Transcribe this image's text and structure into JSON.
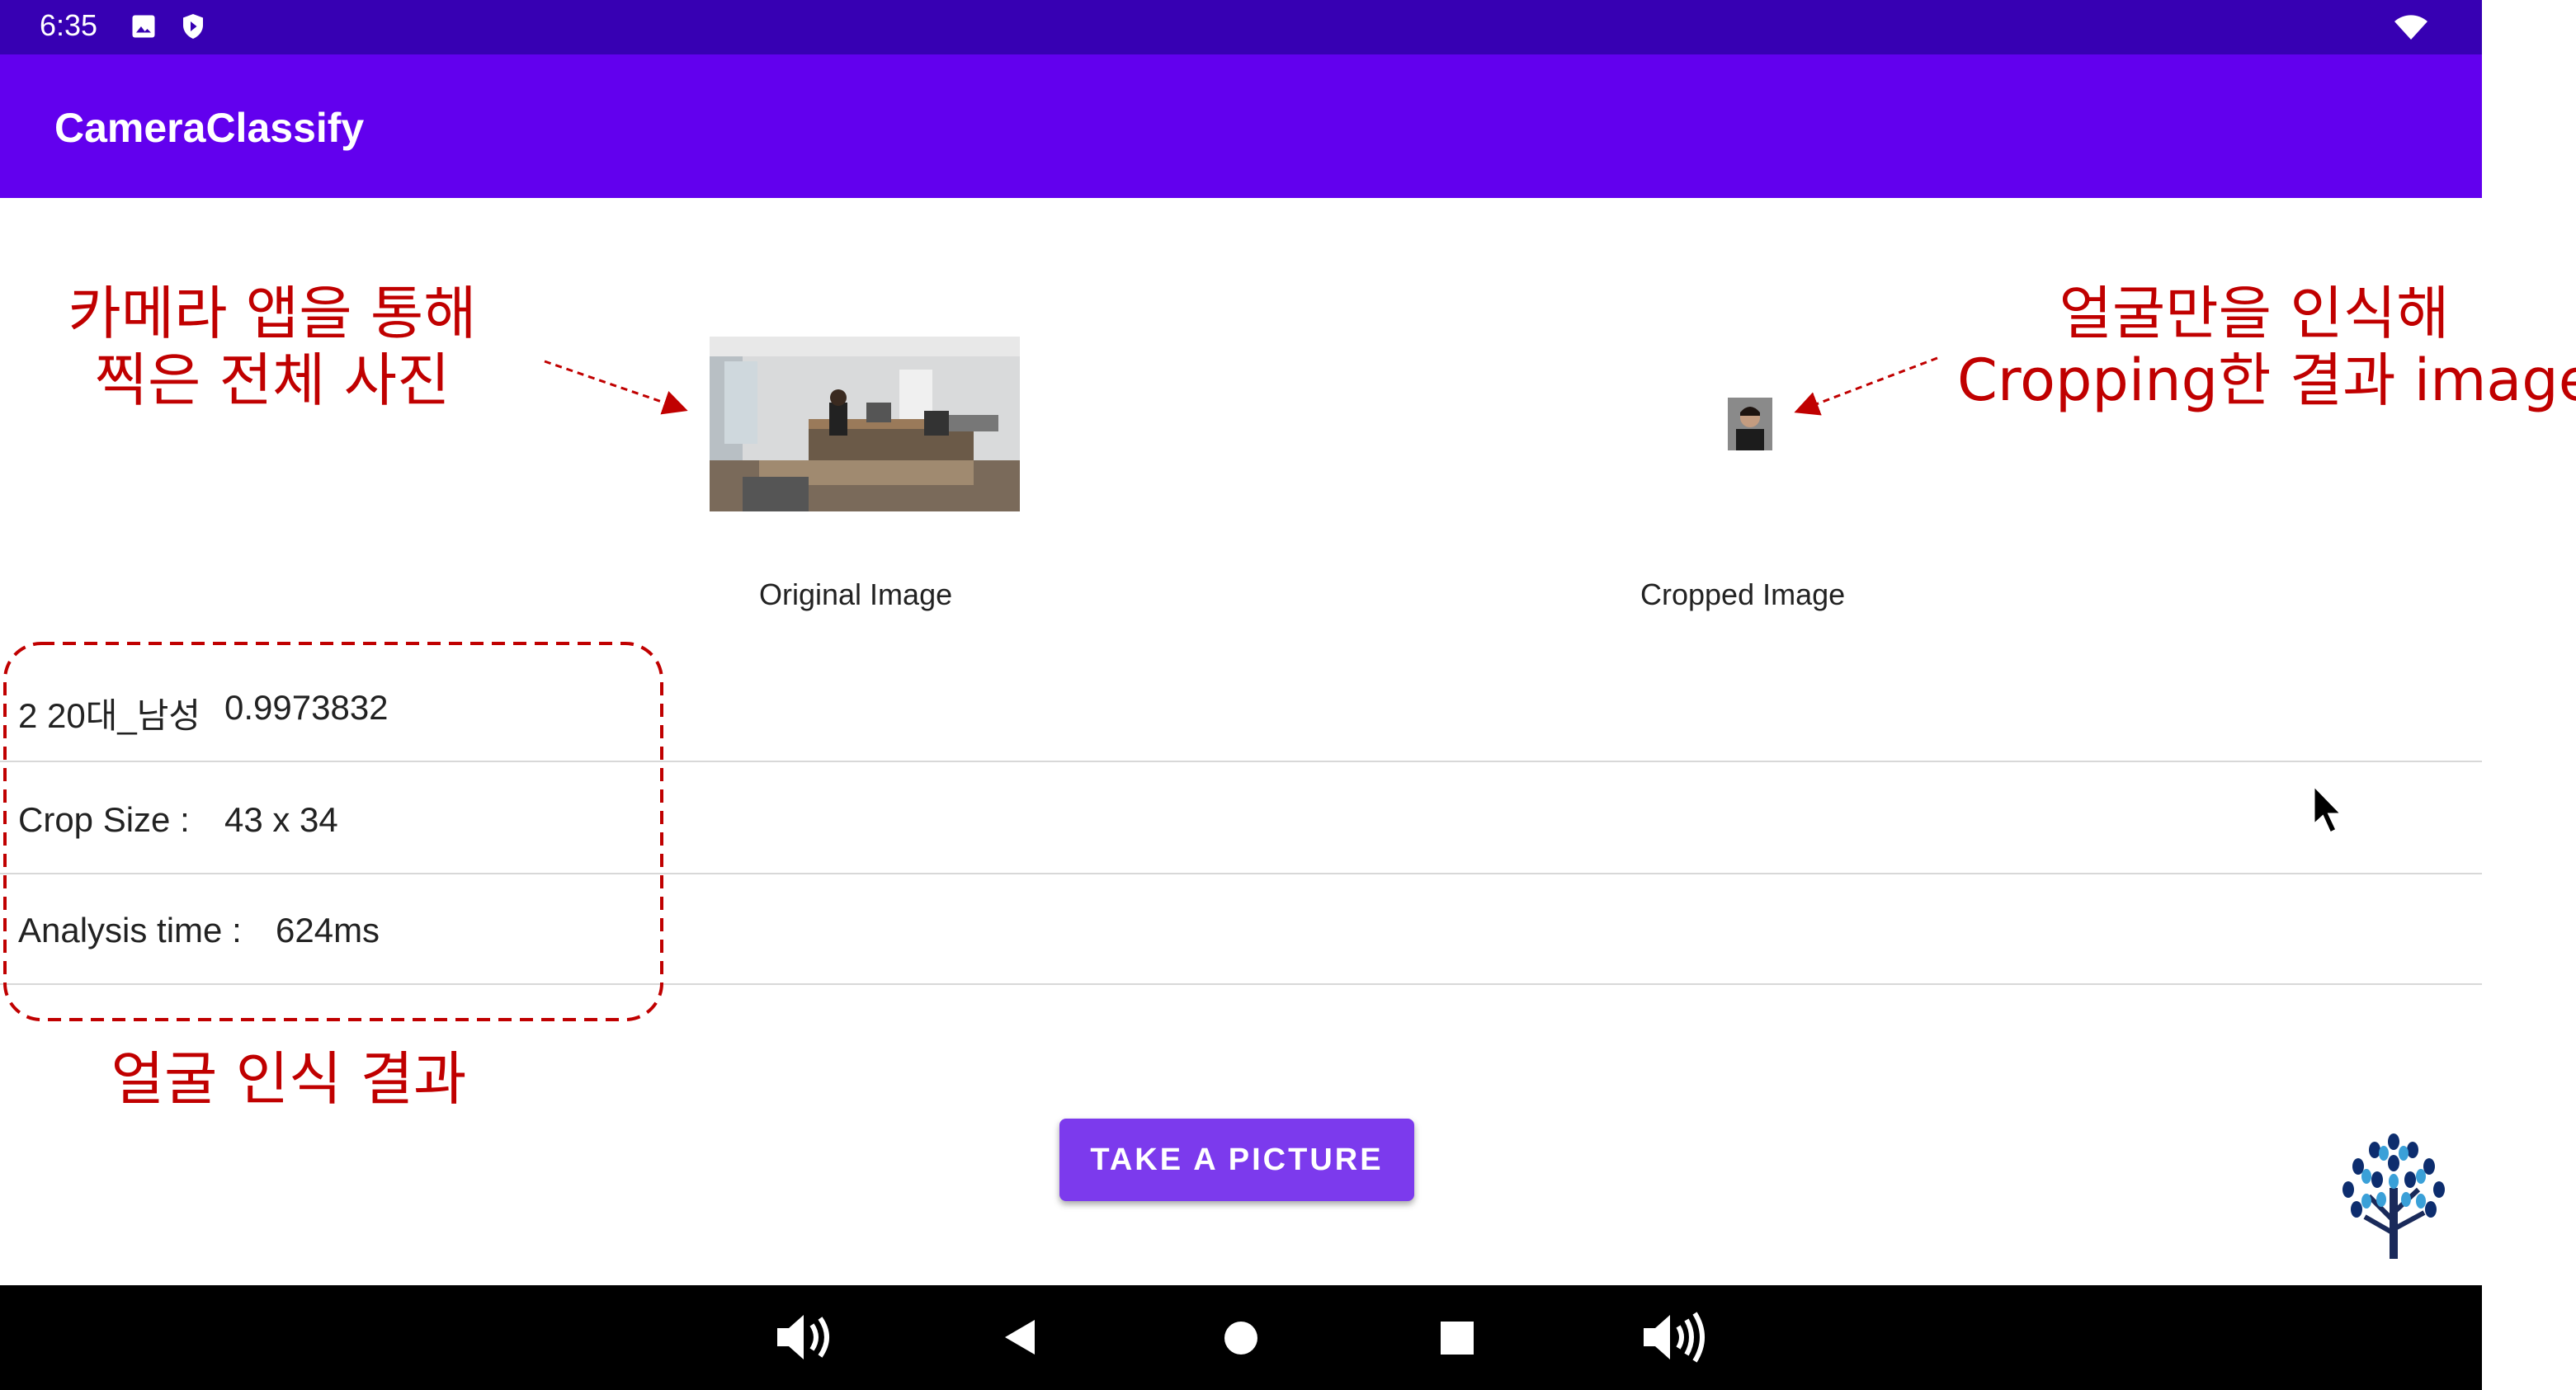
{
  "status_bar": {
    "time": "6:35",
    "icons": [
      "image-icon",
      "shield-icon",
      "wifi-icon"
    ],
    "bg_color": "#3700b3"
  },
  "app_bar": {
    "title": "CameraClassify",
    "bg_color": "#6200ee"
  },
  "images": {
    "original_caption": "Original Image",
    "cropped_caption": "Cropped Image"
  },
  "results": {
    "row1_label": "2 20대_남성",
    "row1_value": "0.9973832",
    "row2_label": "Crop Size :",
    "row2_value": "43 x 34",
    "row3_label": "Analysis time :",
    "row3_value": "624ms"
  },
  "button": {
    "label": "TAKE A PICTURE",
    "color": "#7c3aed"
  },
  "nav_bar": {
    "icons": [
      "volume-down-icon",
      "back-icon",
      "home-icon",
      "recents-icon",
      "volume-up-icon"
    ]
  },
  "annotations": {
    "original_line1": "카메라 앱을 통해",
    "original_line2": "찍은 전체 사진",
    "cropped_line1": "얼굴만을 인식해",
    "cropped_line2": "Cropping한 결과 image",
    "result_note": "얼굴 인식 결과",
    "color": "#c00000"
  },
  "logo": {
    "name": "tree-logo"
  }
}
